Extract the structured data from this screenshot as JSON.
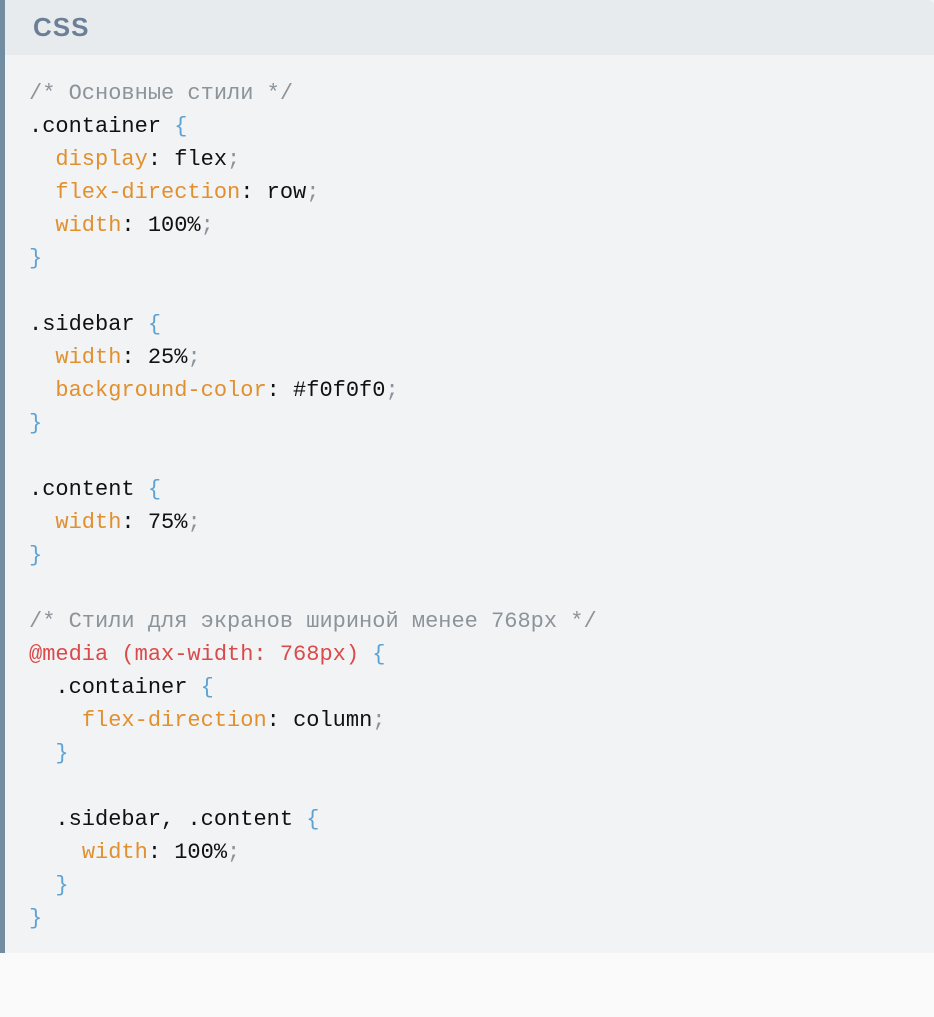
{
  "header": {
    "language": "CSS"
  },
  "lines": {
    "l0": {
      "c0": "/* Основные стили */"
    },
    "l1": {
      "c0": ".container ",
      "c1": "{"
    },
    "l2": {
      "c0": "display",
      "c1": ": ",
      "c2": "flex",
      "c3": ";"
    },
    "l3": {
      "c0": "flex-direction",
      "c1": ": ",
      "c2": "row",
      "c3": ";"
    },
    "l4": {
      "c0": "width",
      "c1": ": ",
      "c2": "100%",
      "c3": ";"
    },
    "l5": {
      "c0": "}"
    },
    "l7": {
      "c0": ".sidebar ",
      "c1": "{"
    },
    "l8": {
      "c0": "width",
      "c1": ": ",
      "c2": "25%",
      "c3": ";"
    },
    "l9": {
      "c0": "background-color",
      "c1": ": ",
      "c2": "#f0f0f0",
      "c3": ";"
    },
    "l10": {
      "c0": "}"
    },
    "l12": {
      "c0": ".content ",
      "c1": "{"
    },
    "l13": {
      "c0": "width",
      "c1": ": ",
      "c2": "75%",
      "c3": ";"
    },
    "l14": {
      "c0": "}"
    },
    "l16": {
      "c0": "/* Стили для экранов шириной менее 768px */"
    },
    "l17": {
      "c0": "@media (max-width: 768px) ",
      "c1": "{"
    },
    "l18": {
      "c0": ".container ",
      "c1": "{"
    },
    "l19": {
      "c0": "flex-direction",
      "c1": ": ",
      "c2": "column",
      "c3": ";"
    },
    "l20": {
      "c0": "}"
    },
    "l22": {
      "c0": ".sidebar",
      "c1": ", ",
      "c2": ".content ",
      "c3": "{"
    },
    "l23": {
      "c0": "width",
      "c1": ": ",
      "c2": "100%",
      "c3": ";"
    },
    "l24": {
      "c0": "}"
    },
    "l25": {
      "c0": "}"
    }
  }
}
